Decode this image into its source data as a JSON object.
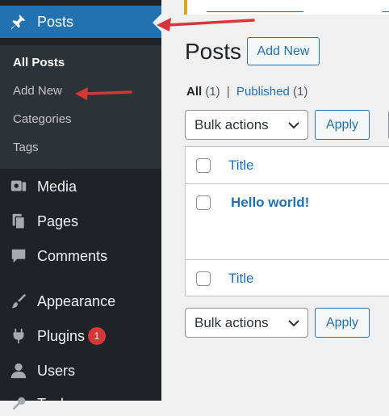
{
  "sidebar": {
    "posts": {
      "label": "Posts",
      "icon": "pushpin-icon"
    },
    "submenu": [
      {
        "label": "All Posts",
        "current": true
      },
      {
        "label": "Add New"
      },
      {
        "label": "Categories"
      },
      {
        "label": "Tags"
      }
    ],
    "items": [
      {
        "label": "Media",
        "icon": "media-icon"
      },
      {
        "label": "Pages",
        "icon": "pages-icon"
      },
      {
        "label": "Comments",
        "icon": "comments-icon"
      },
      {
        "label": "Appearance",
        "icon": "paintbrush-icon"
      },
      {
        "label": "Plugins",
        "icon": "plugin-icon",
        "badge": "1"
      },
      {
        "label": "Users",
        "icon": "users-icon"
      },
      {
        "label": "Tools",
        "icon": "tools-icon"
      }
    ]
  },
  "main": {
    "title": "Posts",
    "add_new_label": "Add New",
    "filters": {
      "all_label": "All",
      "all_count": "(1)",
      "separator": "|",
      "published_label": "Published",
      "published_count": "(1)"
    },
    "bulk_actions_label": "Bulk actions",
    "apply_label": "Apply",
    "table": {
      "column_title": "Title",
      "rows": [
        {
          "title": "Hello world!"
        }
      ]
    }
  },
  "colors": {
    "sidebar_bg": "#1d2327",
    "submenu_bg": "#2c3338",
    "accent": "#2271b1",
    "annotation_arrow": "#d63638",
    "badge": "#d63638"
  }
}
